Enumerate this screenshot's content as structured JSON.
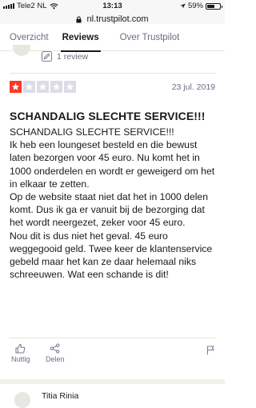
{
  "status_bar": {
    "carrier": "Tele2 NL",
    "time": "13:13",
    "battery": "59%",
    "battery_level": 0.59
  },
  "url_bar": {
    "url": "nl.trustpilot.com"
  },
  "tabs": [
    {
      "label": "Overzicht"
    },
    {
      "label": "Reviews",
      "active": true
    },
    {
      "label": "Over Trustpilot"
    }
  ],
  "reviewer": {
    "review_count": "1 review"
  },
  "review": {
    "rating": 1,
    "rating_max": 5,
    "rating_color": "#ff3722",
    "empty_star_color": "#dcdce6",
    "date": "23 jul. 2019",
    "title": "SCHANDALIG SLECHTE SERVICE!!!",
    "body": [
      "SCHANDALIG SLECHTE SERVICE!!!",
      "Ik heb een loungeset besteld en die bewust laten bezorgen voor 45 euro. Nu komt het in 1000 onderdelen en wordt er geweigerd om het in elkaar te zetten.",
      "Op de website staat niet dat het in 1000 delen komt. Dus ik ga er vanuit bij de bezorging dat het wordt neergezet, zeker voor 45 euro.",
      "Nou dit is dus niet het geval. 45 euro weggegooid geld. Twee keer de klantenservice gebeld maar het kan ze daar helemaal niks schreeuwen. Wat een schande is dit!"
    ]
  },
  "actions": {
    "useful_label": "Nuttig",
    "share_label": "Delen",
    "useful_icon": "thumbs-up-icon",
    "share_icon": "share-icon",
    "flag_icon": "flag-icon"
  },
  "next_reviewer": {
    "name": "Titia Rinia"
  }
}
